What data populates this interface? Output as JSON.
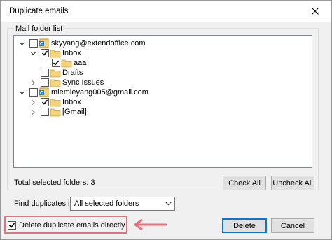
{
  "window": {
    "title": "Duplicate emails"
  },
  "group": {
    "legend": "Mail folder list"
  },
  "tree": {
    "nodes": [
      {
        "label": "skyyang@extendoffice.com",
        "checked": false,
        "expander": "expanded",
        "icon": "mail-account"
      },
      {
        "label": "Inbox",
        "checked": true,
        "expander": "expanded",
        "icon": "folder"
      },
      {
        "label": "aaa",
        "checked": true,
        "expander": "none",
        "icon": "folder"
      },
      {
        "label": "Drafts",
        "checked": false,
        "expander": "none",
        "icon": "folder"
      },
      {
        "label": "Sync Issues",
        "checked": false,
        "expander": "collapsed",
        "icon": "folder"
      },
      {
        "label": "miemieyang005@gmail.com",
        "checked": false,
        "expander": "expanded",
        "icon": "mail-account"
      },
      {
        "label": "Inbox",
        "checked": true,
        "expander": "collapsed",
        "icon": "folder"
      },
      {
        "label": "[Gmail]",
        "checked": false,
        "expander": "collapsed",
        "icon": "folder"
      }
    ]
  },
  "status": {
    "total_label": "Total selected folders:",
    "total_count": "3"
  },
  "buttons": {
    "check_all": "Check All",
    "uncheck_all": "Uncheck All",
    "delete": "Delete",
    "cancel": "Cancel"
  },
  "find": {
    "label": "Find duplicates in:",
    "selected": "All selected folders"
  },
  "options": {
    "delete_directly_label": "Delete duplicate emails directly",
    "delete_directly_checked": true
  },
  "colors": {
    "accent": "#0078d7",
    "highlight": "#e8707c",
    "folder": "#f4d47a"
  }
}
